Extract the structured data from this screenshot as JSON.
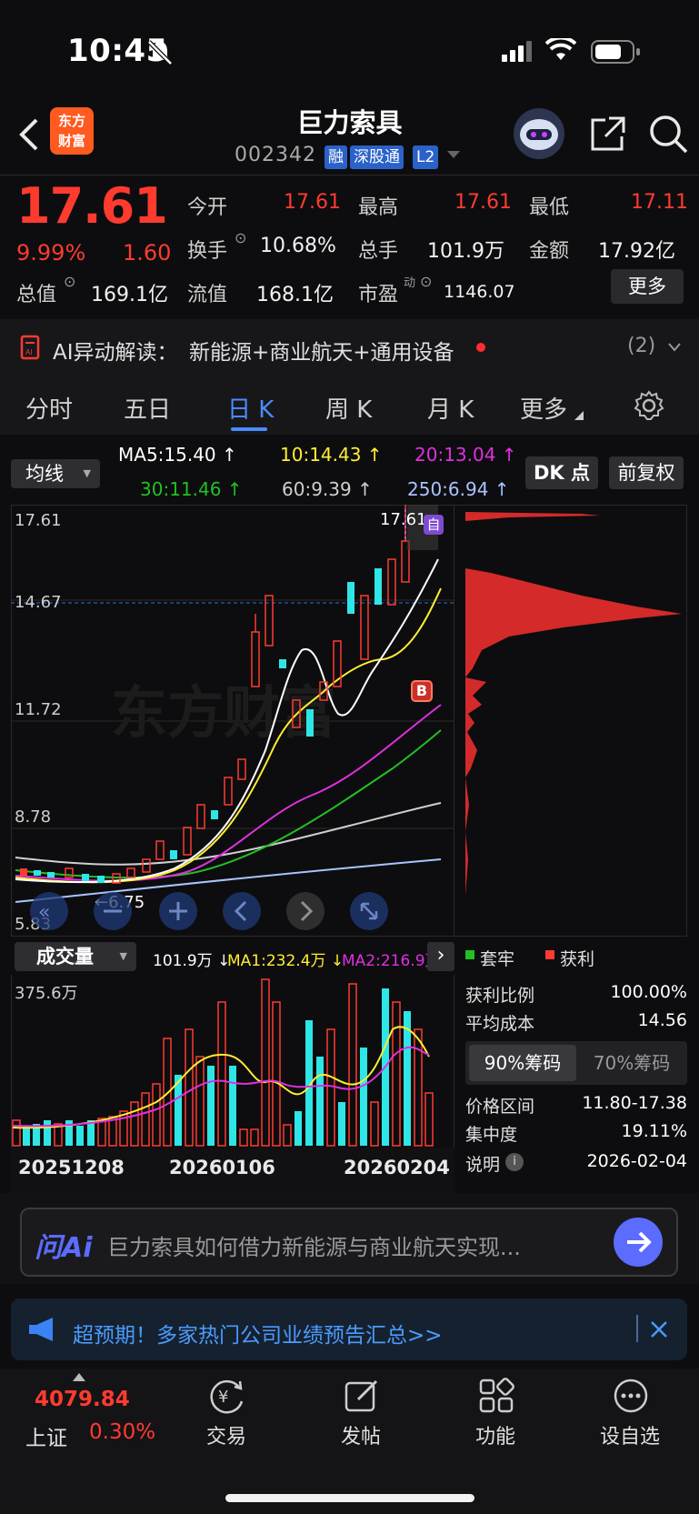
{
  "status": {
    "time": "10:45"
  },
  "header": {
    "title": "巨力索具",
    "code": "002342",
    "tags": [
      "融",
      "深股通",
      "L2"
    ],
    "logo_line1": "东方",
    "logo_line2": "财富"
  },
  "quote": {
    "price": "17.61",
    "change_pct": "9.99%",
    "change": "1.60",
    "open_label": "今开",
    "open": "17.61",
    "high_label": "最高",
    "high": "17.61",
    "low_label": "最低",
    "low": "17.11",
    "turnover_label": "换手",
    "turnover": "10.68%",
    "volume_label": "总手",
    "volume": "101.9万",
    "amount_label": "金额",
    "amount": "17.92亿",
    "total_cap_label": "总值",
    "total_cap": "169.1亿",
    "float_cap_label": "流值",
    "float_cap": "168.1亿",
    "pe_label": "市盈",
    "pe_sup": "动",
    "pe": "1146.07",
    "more_label": "更多"
  },
  "ai_banner": {
    "label": "AI异动解读：",
    "text": "新能源+商业航天+通用设备",
    "count": "(2)"
  },
  "tabs": [
    {
      "label": "分时"
    },
    {
      "label": "五日"
    },
    {
      "label": "日 K",
      "active": true
    },
    {
      "label": "周 K"
    },
    {
      "label": "月 K"
    },
    {
      "label": "更多"
    }
  ],
  "ma": {
    "select_label": "均线",
    "ma5": "MA5:15.40",
    "ma10": "10:14.43",
    "ma20": "20:13.04",
    "ma30": "30:11.46",
    "ma60": "60:9.39",
    "ma250": "250:6.94",
    "dk_label": "DK 点",
    "fq_label": "前复权",
    "colors": {
      "ma5": "#ffffff",
      "ma10": "#ffee33",
      "ma20": "#e030e0",
      "ma30": "#22c022",
      "ma60": "#cfcfcf",
      "ma250": "#a9c4ff"
    }
  },
  "price_axis": {
    "top": "17.61",
    "l2": "14.67",
    "l3": "11.72",
    "l4": "8.78",
    "bottom": "5.83",
    "max_mark": "17.61",
    "min_mark": "←6.75"
  },
  "badges": {
    "b": "B"
  },
  "volume": {
    "select_label": "成交量",
    "vol": "101.9万",
    "ma1": "MA1:232.4万",
    "ma2": "MA2:216.9万",
    "max_label": "375.6万",
    "dates": [
      "20251208",
      "20260106",
      "20260204"
    ]
  },
  "chips": {
    "legend_trap": "套牢",
    "legend_profit": "获利",
    "profit_ratio_label": "获利比例",
    "profit_ratio": "100.00%",
    "avg_cost_label": "平均成本",
    "avg_cost": "14.56",
    "tab90": "90%筹码",
    "tab70": "70%筹码",
    "range_label": "价格区间",
    "range": "11.80-17.38",
    "concentration_label": "集中度",
    "concentration": "19.11%",
    "note_label": "说明",
    "note_date": "2026-02-04"
  },
  "ask_ai": {
    "brand": "问Ai",
    "placeholder": "巨力索具如何借力新能源与商业航天实现..."
  },
  "notice": {
    "text": "超预期！多家热门公司业绩预告汇总>>"
  },
  "bottom_nav": {
    "index_value": "4079.84",
    "index_name": "上证",
    "index_pct": "0.30%",
    "items": [
      {
        "label": "交易"
      },
      {
        "label": "发帖"
      },
      {
        "label": "功能"
      },
      {
        "label": "设自选"
      }
    ]
  }
}
